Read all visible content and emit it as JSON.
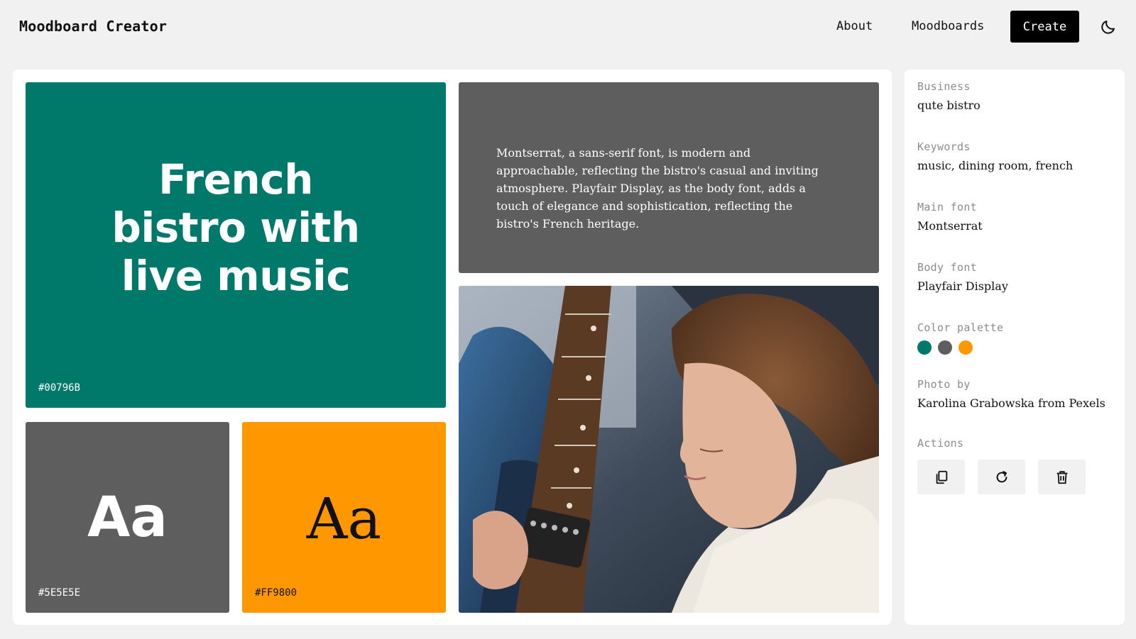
{
  "app": {
    "title": "Moodboard Creator"
  },
  "nav": {
    "about": "About",
    "moodboards": "Moodboards",
    "create": "Create",
    "theme_icon": "moon-icon"
  },
  "board": {
    "headline": "French bistro with live music",
    "primary_hex": "#00796B",
    "secondary_hex": "#5E5E5E",
    "accent_hex": "#FF9800",
    "aa_sans": "Aa",
    "aa_serif": "Aa",
    "description": "Montserrat, a sans-serif font, is modern and approachable, reflecting the bistro's casual and inviting atmosphere. Playfair Display, as the body font, adds a touch of elegance and sophistication, reflecting the bistro's French heritage."
  },
  "sidebar": {
    "business_label": "Business",
    "business_value": "qute bistro",
    "keywords_label": "Keywords",
    "keywords_value": "music, dining room, french",
    "main_font_label": "Main font",
    "main_font_value": "Montserrat",
    "body_font_label": "Body font",
    "body_font_value": "Playfair Display",
    "palette_label": "Color palette",
    "palette": [
      "#00796B",
      "#5E5E5E",
      "#FF9800"
    ],
    "photo_label": "Photo by",
    "photo_value": "Karolina Grabowska from Pexels",
    "actions_label": "Actions",
    "actions": [
      "copy-icon",
      "refresh-icon",
      "trash-icon"
    ]
  }
}
